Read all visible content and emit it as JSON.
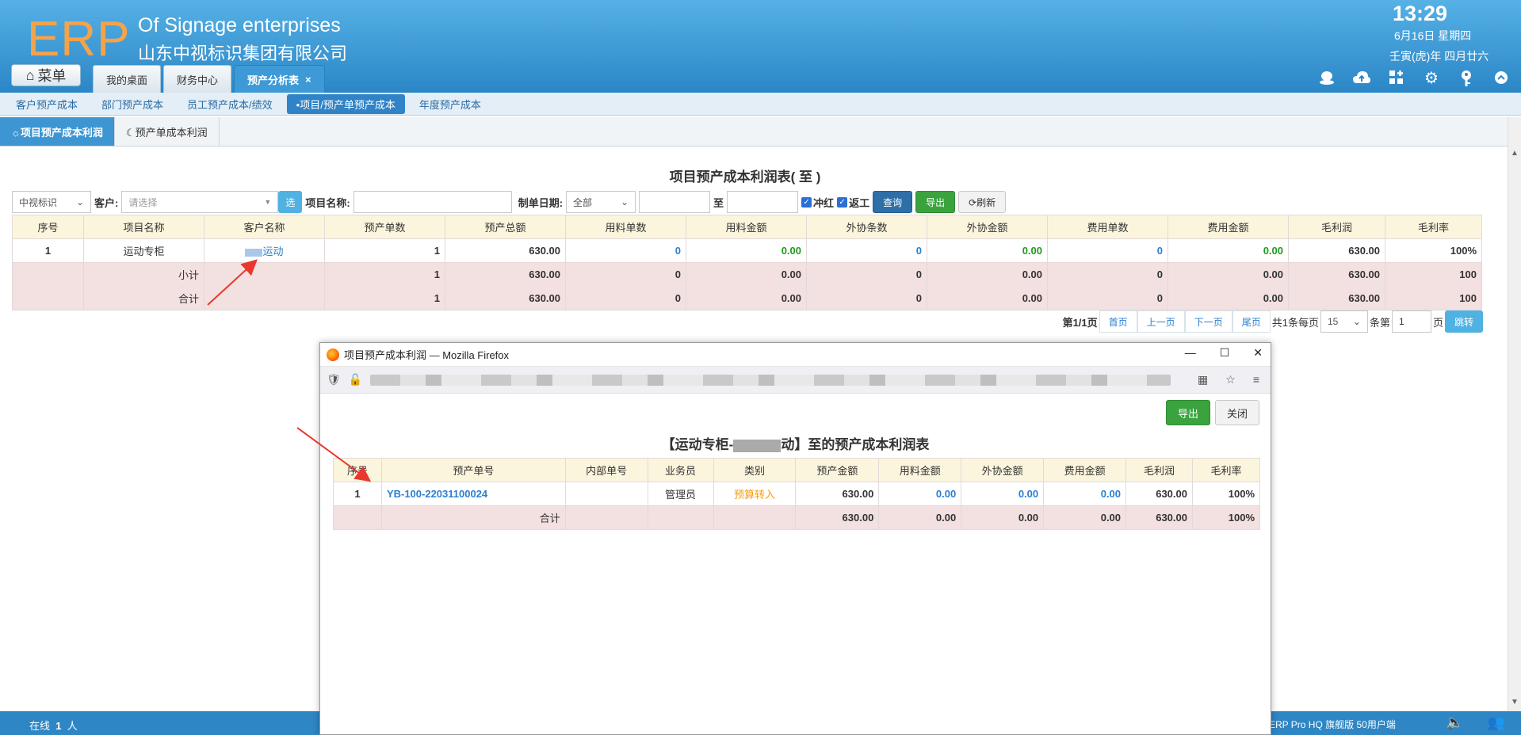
{
  "header": {
    "logo": "ERP",
    "company_en": "Of Signage enterprises",
    "company_cn": "山东中视标识集团有限公司",
    "time": "13:29",
    "date": "6月16日 星期四",
    "lunar": "壬寅(虎)年 四月廿六",
    "menu_label": "菜单",
    "tabs": [
      {
        "label": "我的桌面"
      },
      {
        "label": "财务中心"
      },
      {
        "label": "预产分析表",
        "close": "×"
      }
    ],
    "icons": [
      "user-icon",
      "cloud-icon",
      "apps-icon",
      "gear-icon",
      "key-icon",
      "collapse-icon"
    ]
  },
  "subnav": {
    "items": [
      "客户预产成本",
      "部门预产成本",
      "员工预产成本/绩效",
      "•项目/预产单预产成本",
      "年度预产成本"
    ]
  },
  "pagetabs": {
    "items": [
      "☼项目预产成本利润",
      "☾预产单成本利润"
    ]
  },
  "report": {
    "title": "项目预产成本利润表( 至 )",
    "filters": {
      "company": "中视标识",
      "customer_label": "客户:",
      "customer_placeholder": "请选择",
      "select_btn": "选",
      "project_label": "项目名称:",
      "date_label": "制单日期:",
      "date_range": "全部",
      "to": "至",
      "chk_red": "冲红",
      "chk_return": "返工",
      "query": "查询",
      "export": "导出",
      "refresh": "⟳刷新"
    },
    "columns": [
      "序号",
      "项目名称",
      "客户名称",
      "预产单数",
      "预产总额",
      "用料单数",
      "用料金额",
      "外协条数",
      "外协金额",
      "费用单数",
      "费用金额",
      "毛利润",
      "毛利率"
    ],
    "rows": [
      {
        "no": "1",
        "project": "运动专柜",
        "customer": "运动",
        "orders": "1",
        "total": "630.00",
        "mat_cnt": "0",
        "mat_amt": "0.00",
        "out_cnt": "0",
        "out_amt": "0.00",
        "fee_cnt": "0",
        "fee_amt": "0.00",
        "profit": "630.00",
        "rate": "100%"
      }
    ],
    "subtotal": {
      "label": "小计",
      "orders": "1",
      "total": "630.00",
      "mat_cnt": "0",
      "mat_amt": "0.00",
      "out_cnt": "0",
      "out_amt": "0.00",
      "fee_cnt": "0",
      "fee_amt": "0.00",
      "profit": "630.00",
      "rate": "100"
    },
    "grandtotal": {
      "label": "合计",
      "orders": "1",
      "total": "630.00",
      "mat_cnt": "0",
      "mat_amt": "0.00",
      "out_cnt": "0",
      "out_amt": "0.00",
      "fee_cnt": "0",
      "fee_amt": "0.00",
      "profit": "630.00",
      "rate": "100"
    },
    "pager": {
      "page_info": "第1/1页",
      "first": "首页",
      "prev": "上一页",
      "next": "下一页",
      "last": "尾页",
      "total": "共1条每页",
      "per_page": "15",
      "goto_label": "条第",
      "goto_value": "1",
      "page_suffix": "页",
      "jump": "跳转"
    }
  },
  "popup": {
    "window_title": "项目预产成本利润 — Mozilla Firefox",
    "export": "导出",
    "close": "关闭",
    "title_prefix": "【运动专柜-",
    "title_suffix": "动】至的预产成本利润表",
    "columns": [
      "序号",
      "预产单号",
      "内部单号",
      "业务员",
      "类别",
      "预产金额",
      "用料金额",
      "外协金额",
      "费用金额",
      "毛利润",
      "毛利率"
    ],
    "rows": [
      {
        "no": "1",
        "order_no": "YB-100-22031100024",
        "internal": "",
        "salesman": "管理员",
        "category": "预算转入",
        "amount": "630.00",
        "mat": "0.00",
        "out": "0.00",
        "fee": "0.00",
        "profit": "630.00",
        "rate": "100%"
      }
    ],
    "total": {
      "label": "合计",
      "amount": "630.00",
      "mat": "0.00",
      "out": "0.00",
      "fee": "0.00",
      "profit": "630.00",
      "rate": "100%"
    }
  },
  "footer": {
    "online_prefix": "在线",
    "online_count": "1",
    "online_suffix": "人",
    "version": "ERP Pro HQ 旗舰版 50用户端"
  },
  "colors": {
    "header_top": "#56b1e6",
    "header_bottom": "#2b86c6",
    "accent": "#2f83c6",
    "arrow": "#e8372c"
  }
}
